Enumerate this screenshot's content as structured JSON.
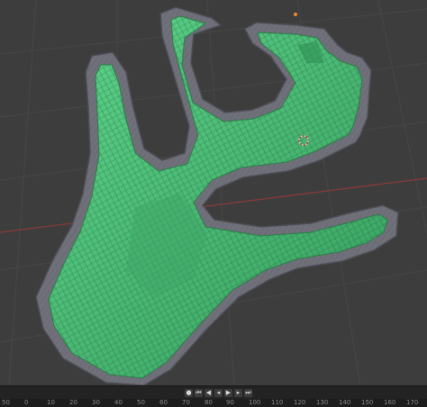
{
  "viewport": {
    "object_name": "green hand-shaped mesh",
    "cursor_icon": "3d-cursor-icon",
    "colors": {
      "background": "#3d3d3d",
      "grid_line": "#4a4a4a",
      "x_axis": "#8b3a3a",
      "mesh_face": "#4fc27c",
      "mesh_edge": "#6f7079",
      "wire": "#1f3d2a"
    }
  },
  "timeline": {
    "buttons": [
      {
        "icon": "record-icon",
        "glyph": "●"
      },
      {
        "icon": "jump-start-icon",
        "glyph": "⏮"
      },
      {
        "icon": "prev-keyframe-icon",
        "glyph": "◀"
      },
      {
        "icon": "play-reverse-icon",
        "glyph": "◂"
      },
      {
        "icon": "play-icon",
        "glyph": "▶"
      },
      {
        "icon": "next-keyframe-icon",
        "glyph": "▸"
      },
      {
        "icon": "jump-end-icon",
        "glyph": "⏭"
      }
    ],
    "ruler_ticks": [
      "50",
      "0",
      "10",
      "20",
      "30",
      "40",
      "50",
      "60",
      "70",
      "80",
      "90",
      "100",
      "110",
      "120",
      "130",
      "140",
      "150",
      "160",
      "170"
    ]
  }
}
